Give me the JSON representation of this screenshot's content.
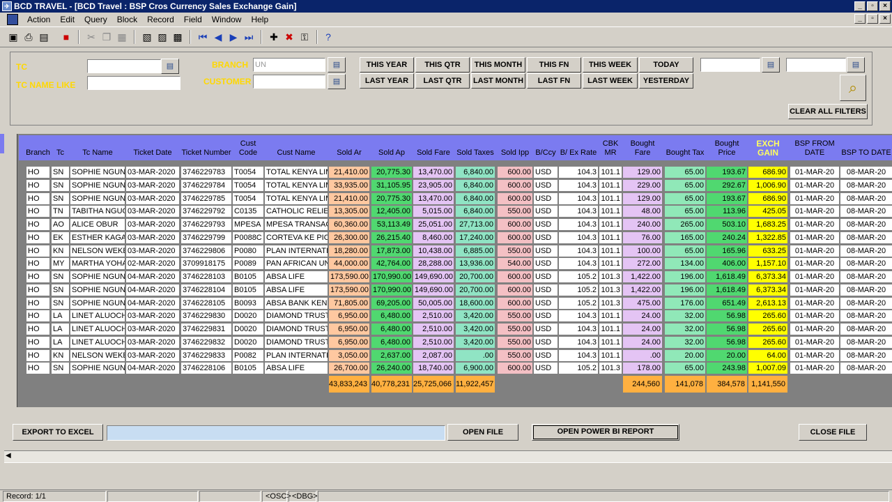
{
  "window": {
    "title": "BCD TRAVEL - [BCD Travel : BSP Cros Currency Sales Exchange Gain]",
    "app_icon_text": "BCD"
  },
  "menu": {
    "items": [
      "Action",
      "Edit",
      "Query",
      "Block",
      "Record",
      "Field",
      "Window",
      "Help"
    ]
  },
  "toolbar": {
    "icons": [
      "save-icon",
      "print-icon",
      "print-setup-icon",
      "exit-icon",
      "cut-icon",
      "copy-icon",
      "paste-icon",
      "enter-query-icon",
      "execute-query-icon",
      "cancel-query-icon",
      "first-record-icon",
      "previous-record-icon",
      "next-record-icon",
      "last-record-icon",
      "insert-record-icon",
      "delete-record-icon",
      "lock-record-icon",
      "help-icon"
    ]
  },
  "filters": {
    "tc_label": "TC",
    "tc_name_like_label": "TC NAME LIKE",
    "branch_label": "BRANCH",
    "branch_value": "UN",
    "customer_label": "CUSTOMER",
    "tc_value": "",
    "tc_name_value": "",
    "customer_value": "",
    "date_from_value": "",
    "date_to_value": "",
    "period_buttons_top": [
      "THIS YEAR",
      "THIS QTR",
      "THIS MONTH",
      "THIS FN",
      "THIS WEEK",
      "TODAY"
    ],
    "period_buttons_bottom": [
      "LAST YEAR",
      "LAST QTR",
      "LAST MONTH",
      "LAST FN",
      "LAST WEEK",
      "YESTERDAY"
    ],
    "clear_label": "CLEAR ALL FILTERS"
  },
  "table": {
    "headers": [
      "Branch",
      "Tc",
      "Tc Name",
      "Ticket Date",
      "Ticket Number",
      "Cust Code",
      "Cust Name",
      "Sold Ar",
      "Sold Ap",
      "Sold Fare",
      "Sold Taxes",
      "Sold Ipp",
      "B/Ccy",
      "B/ Ex Rate",
      "CBK MR",
      "Bought Fare",
      "Bought Tax",
      "Bought Price",
      "EXCH GAIN",
      "BSP FROM DATE",
      "BSP TO DATE"
    ],
    "rows": [
      [
        "HO",
        "SN",
        "SOPHIE NGUNJI",
        "03-MAR-2020",
        "3746229783",
        "T0054",
        "TOTAL KENYA LIMI",
        "21,410.00",
        "20,775.30",
        "13,470.00",
        "6,840.00",
        "600.00",
        "USD",
        "104.3",
        "101.1",
        "129.00",
        "65.00",
        "193.67",
        "686.90",
        "01-MAR-20",
        "08-MAR-20"
      ],
      [
        "HO",
        "SN",
        "SOPHIE NGUNJI",
        "03-MAR-2020",
        "3746229784",
        "T0054",
        "TOTAL KENYA LIMI",
        "33,935.00",
        "31,105.95",
        "23,905.00",
        "6,840.00",
        "600.00",
        "USD",
        "104.3",
        "101.1",
        "229.00",
        "65.00",
        "292.67",
        "1,006.90",
        "01-MAR-20",
        "08-MAR-20"
      ],
      [
        "HO",
        "SN",
        "SOPHIE NGUNJI",
        "03-MAR-2020",
        "3746229785",
        "T0054",
        "TOTAL KENYA LIMI",
        "21,410.00",
        "20,775.30",
        "13,470.00",
        "6,840.00",
        "600.00",
        "USD",
        "104.3",
        "101.1",
        "129.00",
        "65.00",
        "193.67",
        "686.90",
        "01-MAR-20",
        "08-MAR-20"
      ],
      [
        "HO",
        "TN",
        "TABITHA NGUGI",
        "03-MAR-2020",
        "3746229792",
        "C0135",
        "CATHOLIC RELIEF",
        "13,305.00",
        "12,405.00",
        "5,015.00",
        "6,840.00",
        "550.00",
        "USD",
        "104.3",
        "101.1",
        "48.00",
        "65.00",
        "113.96",
        "425.05",
        "01-MAR-20",
        "08-MAR-20"
      ],
      [
        "HO",
        "AO",
        "ALICE OBUR",
        "03-MAR-2020",
        "3746229793",
        "MPESA",
        "MPESA TRANSACT",
        "60,360.00",
        "53,113.49",
        "25,051.00",
        "27,713.00",
        "600.00",
        "USD",
        "104.3",
        "101.1",
        "240.00",
        "265.00",
        "503.10",
        "1,683.25",
        "01-MAR-20",
        "08-MAR-20"
      ],
      [
        "HO",
        "EK",
        "ESTHER KAGAG",
        "03-MAR-2020",
        "3746229799",
        "P0088C",
        "CORTEVA KE PION",
        "26,300.00",
        "26,215.40",
        "8,460.00",
        "17,240.00",
        "600.00",
        "USD",
        "104.3",
        "101.1",
        "76.00",
        "165.00",
        "240.24",
        "1,322.85",
        "01-MAR-20",
        "08-MAR-20"
      ],
      [
        "HO",
        "KN",
        "NELSON WEKES",
        "03-MAR-2020",
        "3746229806",
        "P0080",
        "PLAN INTERNATIO",
        "18,280.00",
        "17,873.00",
        "10,438.00",
        "6,885.00",
        "550.00",
        "USD",
        "104.3",
        "101.1",
        "100.00",
        "65.00",
        "165.96",
        "633.25",
        "01-MAR-20",
        "08-MAR-20"
      ],
      [
        "HO",
        "MY",
        "MARTHA YOHAN",
        "02-MAR-2020",
        "3709918175",
        "P0089",
        "PAN AFRICAN UNI",
        "44,000.00",
        "42,764.00",
        "28,288.00",
        "13,936.00",
        "540.00",
        "USD",
        "104.3",
        "101.1",
        "272.00",
        "134.00",
        "406.00",
        "1,157.10",
        "01-MAR-20",
        "08-MAR-20"
      ],
      [
        "HO",
        "SN",
        "SOPHIE NGUNJI",
        "04-MAR-2020",
        "3746228103",
        "B0105",
        "ABSA LIFE",
        "173,590.00",
        "170,990.00",
        "149,690.00",
        "20,700.00",
        "600.00",
        "USD",
        "105.2",
        "101.3",
        "1,422.00",
        "196.00",
        "1,618.49",
        "6,373.34",
        "01-MAR-20",
        "08-MAR-20"
      ],
      [
        "HO",
        "SN",
        "SOPHIE NGUNJI",
        "04-MAR-2020",
        "3746228104",
        "B0105",
        "ABSA LIFE",
        "173,590.00",
        "170,990.00",
        "149,690.00",
        "20,700.00",
        "600.00",
        "USD",
        "105.2",
        "101.3",
        "1,422.00",
        "196.00",
        "1,618.49",
        "6,373.34",
        "01-MAR-20",
        "08-MAR-20"
      ],
      [
        "HO",
        "SN",
        "SOPHIE NGUNJI",
        "04-MAR-2020",
        "3746228105",
        "B0093",
        "ABSA BANK KENYA",
        "71,805.00",
        "69,205.00",
        "50,005.00",
        "18,600.00",
        "600.00",
        "USD",
        "105.2",
        "101.3",
        "475.00",
        "176.00",
        "651.49",
        "2,613.13",
        "01-MAR-20",
        "08-MAR-20"
      ],
      [
        "HO",
        "LA",
        "LINET ALUOCH",
        "03-MAR-2020",
        "3746229830",
        "D0020",
        "DIAMOND TRUST E",
        "6,950.00",
        "6,480.00",
        "2,510.00",
        "3,420.00",
        "550.00",
        "USD",
        "104.3",
        "101.1",
        "24.00",
        "32.00",
        "56.98",
        "265.60",
        "01-MAR-20",
        "08-MAR-20"
      ],
      [
        "HO",
        "LA",
        "LINET ALUOCH",
        "03-MAR-2020",
        "3746229831",
        "D0020",
        "DIAMOND TRUST E",
        "6,950.00",
        "6,480.00",
        "2,510.00",
        "3,420.00",
        "550.00",
        "USD",
        "104.3",
        "101.1",
        "24.00",
        "32.00",
        "56.98",
        "265.60",
        "01-MAR-20",
        "08-MAR-20"
      ],
      [
        "HO",
        "LA",
        "LINET ALUOCH",
        "03-MAR-2020",
        "3746229832",
        "D0020",
        "DIAMOND TRUST E",
        "6,950.00",
        "6,480.00",
        "2,510.00",
        "3,420.00",
        "550.00",
        "USD",
        "104.3",
        "101.1",
        "24.00",
        "32.00",
        "56.98",
        "265.60",
        "01-MAR-20",
        "08-MAR-20"
      ],
      [
        "HO",
        "KN",
        "NELSON WEKES",
        "03-MAR-2020",
        "3746229833",
        "P0082",
        "PLAN INTERNATIO",
        "3,050.00",
        "2,637.00",
        "2,087.00",
        ".00",
        "550.00",
        "USD",
        "104.3",
        "101.1",
        ".00",
        "20.00",
        "20.00",
        "64.00",
        "01-MAR-20",
        "08-MAR-20"
      ],
      [
        "HO",
        "SN",
        "SOPHIE NGUNJI",
        "04-MAR-2020",
        "3746228106",
        "B0105",
        "ABSA LIFE",
        "26,700.00",
        "26,240.00",
        "18,740.00",
        "6,900.00",
        "600.00",
        "USD",
        "105.2",
        "101.3",
        "178.00",
        "65.00",
        "243.98",
        "1,007.09",
        "01-MAR-20",
        "08-MAR-20"
      ]
    ],
    "totals": {
      "sold_ar": "43,833,243",
      "sold_ap": "40,778,231",
      "sold_fare": "25,725,066",
      "sold_taxes": "11,922,457",
      "bought_fare": "244,560",
      "bought_tax": "141,078",
      "bought_price": "384,578",
      "exch_gain": "1,141,550"
    }
  },
  "actions": {
    "export": "EXPORT TO EXCEL",
    "file_path": "",
    "open_file": "OPEN FILE",
    "power_bi": "OPEN POWER BI REPORT",
    "close_file": "CLOSE FILE"
  },
  "status": {
    "record": "Record: 1/1",
    "osc": "<OSC>",
    "dbg": "<DBG>"
  },
  "colors": {
    "header_bg": "#7b7bf0",
    "label_yellow": "#ffd800",
    "sold_ar": "#ffc8a0",
    "sold_ap": "#50d870",
    "exch_gain": "#ffff00"
  }
}
